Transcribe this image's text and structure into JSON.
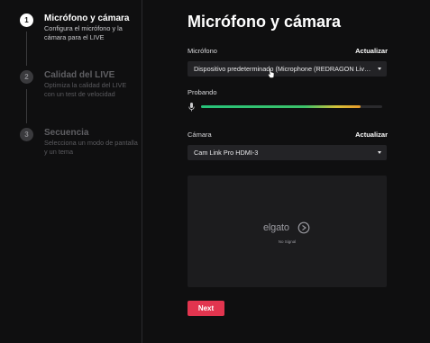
{
  "steps": [
    {
      "number": "1",
      "title": "Micrófono y cámara",
      "description": "Configura el micrófono y la cámara para el LIVE",
      "active": true
    },
    {
      "number": "2",
      "title": "Calidad del LIVE",
      "description": "Optimiza la calidad del LIVE con un test de velocidad",
      "active": false
    },
    {
      "number": "3",
      "title": "Secuencia",
      "description": "Selecciona un modo de pantalla y un tema",
      "active": false
    }
  ],
  "page": {
    "title": "Micrófono y cámara"
  },
  "microphone": {
    "label": "Micrófono",
    "refresh_label": "Actualizar",
    "selected": "Dispositivo predeterminado (Microphone (REDRAGON Live Camera))"
  },
  "testing": {
    "label": "Probando",
    "level": 0.88,
    "icon": "microphone-icon"
  },
  "camera": {
    "label": "Cámara",
    "refresh_label": "Actualizar",
    "selected": "Cam Link Pro HDMI-3"
  },
  "preview": {
    "brand_text": "elgato",
    "status_text": "No Signal"
  },
  "actions": {
    "next_label": "Next"
  },
  "colors": {
    "accent": "#e2354f",
    "meter_green": "#27c27a",
    "meter_yellow": "#d6c23a",
    "background": "#0f0f10"
  }
}
